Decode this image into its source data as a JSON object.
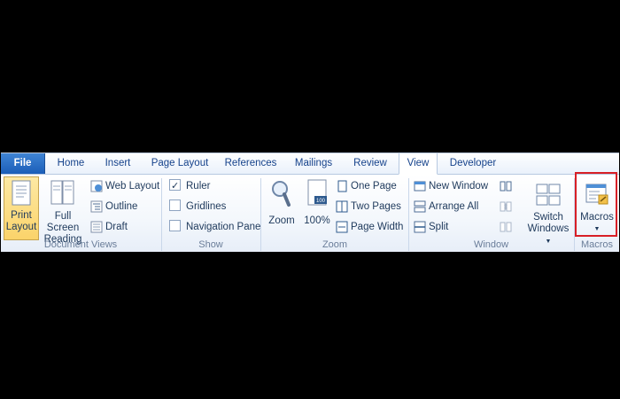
{
  "tabs": {
    "file": "File",
    "items": [
      "Home",
      "Insert",
      "Page Layout",
      "References",
      "Mailings",
      "Review",
      "View",
      "Developer"
    ],
    "active": "View"
  },
  "groups": {
    "document_views": {
      "label": "Document Views",
      "print_layout": [
        "Print",
        "Layout"
      ],
      "full_screen": [
        "Full Screen",
        "Reading"
      ],
      "web_layout": "Web Layout",
      "outline": "Outline",
      "draft": "Draft"
    },
    "show": {
      "label": "Show",
      "ruler": "Ruler",
      "ruler_checked": true,
      "gridlines": "Gridlines",
      "gridlines_checked": false,
      "navigation_pane": "Navigation Pane",
      "navigation_checked": false
    },
    "zoom": {
      "label": "Zoom",
      "zoom": "Zoom",
      "percent": "100%",
      "one_page": "One Page",
      "two_pages": "Two Pages",
      "page_width": "Page Width"
    },
    "window": {
      "label": "Window",
      "new_window": "New Window",
      "arrange_all": "Arrange All",
      "split": "Split",
      "switch": [
        "Switch",
        "Windows"
      ]
    },
    "macros": {
      "label": "Macros",
      "macros": "Macros"
    }
  },
  "colors": {
    "highlight": "#d81f26",
    "file_tab": "#2a6cc7",
    "selected_button": "#fbd36a"
  }
}
